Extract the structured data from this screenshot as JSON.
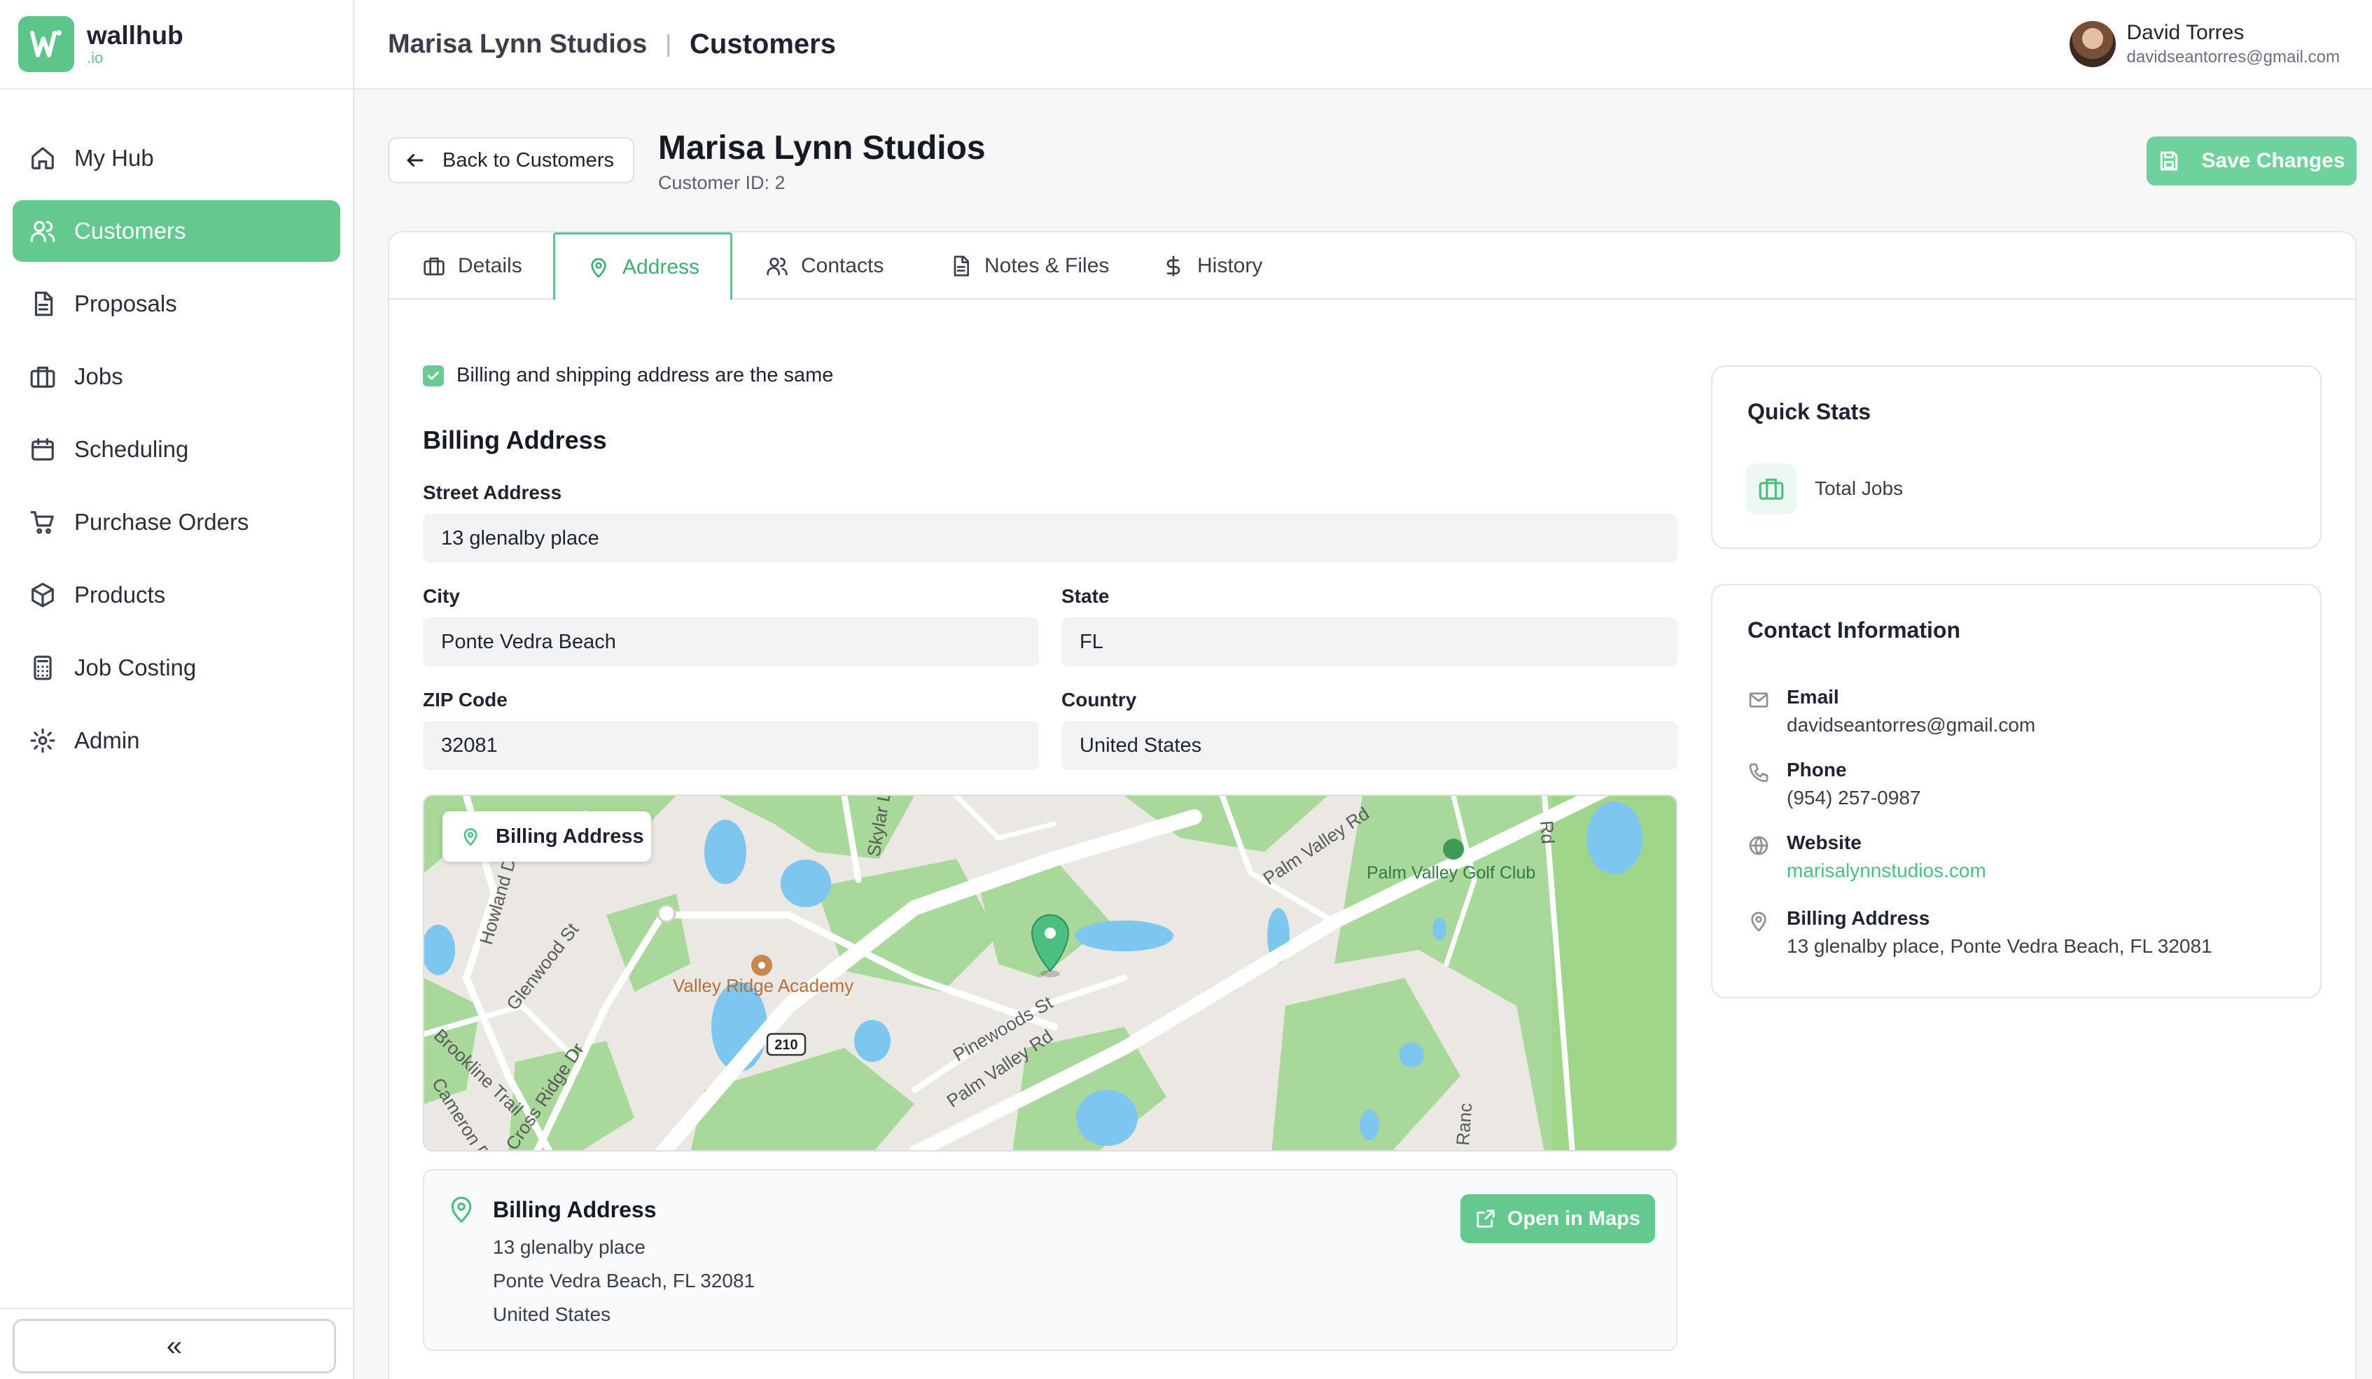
{
  "brand": {
    "name": "wallhub",
    "suffix": ".io"
  },
  "sidebar": {
    "items": [
      {
        "label": "My Hub",
        "icon": "home-icon"
      },
      {
        "label": "Customers",
        "icon": "users-icon",
        "active": true
      },
      {
        "label": "Proposals",
        "icon": "document-icon"
      },
      {
        "label": "Jobs",
        "icon": "briefcase-icon"
      },
      {
        "label": "Scheduling",
        "icon": "calendar-icon"
      },
      {
        "label": "Purchase Orders",
        "icon": "cart-icon"
      },
      {
        "label": "Products",
        "icon": "box-icon"
      },
      {
        "label": "Job Costing",
        "icon": "calculator-icon"
      },
      {
        "label": "Admin",
        "icon": "gear-icon"
      }
    ],
    "collapse_label": "«"
  },
  "topbar": {
    "company": "Marisa Lynn Studios",
    "separator": "|",
    "section": "Customers",
    "user_name": "David Torres",
    "user_email": "davidseantorres@gmail.com"
  },
  "header": {
    "back_label": "Back to Customers",
    "title": "Marisa Lynn Studios",
    "subtitle": "Customer ID: 2",
    "save_label": "Save Changes"
  },
  "tabs": [
    {
      "label": "Details",
      "icon": "briefcase-icon"
    },
    {
      "label": "Address",
      "icon": "map-pin-icon",
      "active": true
    },
    {
      "label": "Contacts",
      "icon": "users-icon"
    },
    {
      "label": "Notes & Files",
      "icon": "document-icon"
    },
    {
      "label": "History",
      "icon": "dollar-icon"
    }
  ],
  "address": {
    "same_label": "Billing and shipping address are the same",
    "same_checked": true,
    "section_title": "Billing Address",
    "street_label": "Street Address",
    "street_value": "13 glenalby place",
    "city_label": "City",
    "city_value": "Ponte Vedra Beach",
    "state_label": "State",
    "state_value": "FL",
    "zip_label": "ZIP Code",
    "zip_value": "32081",
    "country_label": "Country",
    "country_value": "United States"
  },
  "map": {
    "chip_label": "Billing Address",
    "labels": {
      "valley_ridge": "Valley Ridge Academy",
      "palm_valley_golf": "Palm Valley Golf Club",
      "palm_valley_rd_1": "Palm Valley Rd",
      "palm_valley_rd_2": "Palm Valley Rd",
      "pinewoods": "Pinewoods St",
      "glenwood": "Glenwood St",
      "howland": "Howland D",
      "brookline": "Brookline Trail",
      "cameron": "Cameron D",
      "cross_ridge": "Cross Ridge Dr",
      "skylar": "Skylar L",
      "route": "210",
      "ranc": "Ranc",
      "rd": "Rd"
    }
  },
  "address_card": {
    "title": "Billing Address",
    "line1": "13 glenalby place",
    "line2": "Ponte Vedra Beach, FL 32081",
    "line3": "United States",
    "open_label": "Open in Maps"
  },
  "quick_stats": {
    "title": "Quick Stats",
    "total_jobs_label": "Total Jobs"
  },
  "contact_info": {
    "title": "Contact Information",
    "email_label": "Email",
    "email_value": "davidseantorres@gmail.com",
    "phone_label": "Phone",
    "phone_value": "(954) 257-0987",
    "website_label": "Website",
    "website_value": "marisalynnstudios.com",
    "billing_label": "Billing Address",
    "billing_value": "13 glenalby place, Ponte Vedra Beach, FL 32081"
  },
  "colors": {
    "accent": "#63c98f",
    "accent_text": "#3fae73",
    "map_green": "#9fd68a",
    "map_water": "#74c2f0"
  }
}
